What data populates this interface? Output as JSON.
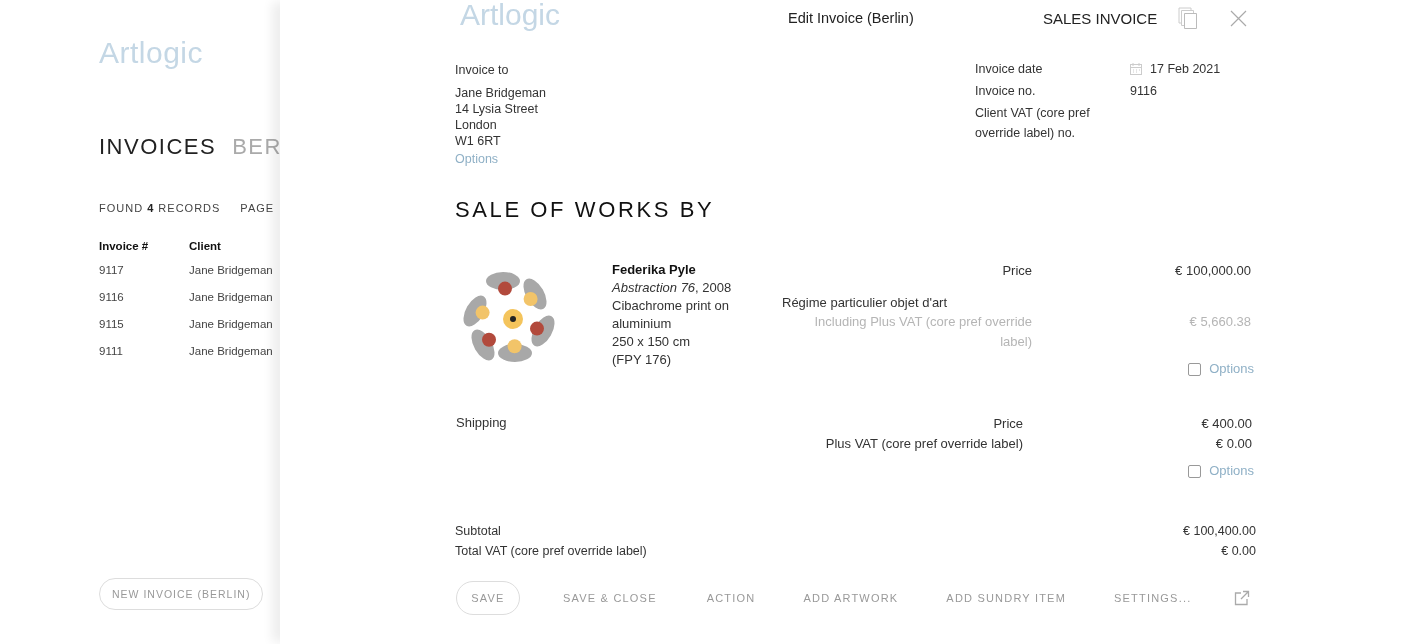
{
  "list_page": {
    "logo": "Artlogic",
    "title": "INVOICES",
    "title_suffix": "BER",
    "records": "FOUND **4** RECORDS",
    "page_label": "PAGE",
    "table": {
      "columns": [
        "Invoice #",
        "Client"
      ],
      "rows": [
        [
          "9117",
          "Jane Bridgeman"
        ],
        [
          "9116",
          "Jane Bridgeman"
        ],
        [
          "9115",
          "Jane Bridgeman"
        ],
        [
          "9111",
          "Jane Bridgeman"
        ]
      ]
    },
    "new_button": "NEW INVOICE (BERLIN)"
  },
  "invoice_panel": {
    "logo": "Artlogic",
    "title": "Edit Invoice (Berlin)",
    "invoice_type": "SALES INVOICE",
    "invoice_to": {
      "label": "Invoice to",
      "address": [
        "Jane Bridgeman",
        "14 Lysia Street",
        "London",
        "W1 6RT"
      ],
      "options": "Options"
    },
    "details": [
      {
        "kind": "date",
        "label": "Invoice date",
        "value": "17 Feb 2021"
      },
      {
        "kind": "text",
        "label": "Invoice no.",
        "value": "9116"
      },
      {
        "kind": "text",
        "label": "Client VAT (core pref override label) no."
      }
    ],
    "section_title": "SALE OF WORKS BY",
    "items": [
      {
        "kind": "artwork",
        "artist": "Federika Pyle",
        "title_line": "*Abstraction 76*, 2008",
        "medium": "Cibachrome print on aluminium",
        "dimensions": "250 x 150 cm",
        "reference": "(FPY 176)",
        "lines": [
          {
            "kind": "amount",
            "label": "Price",
            "value": "€ 100,000.00",
            "muted": false
          },
          {
            "kind": "note",
            "label": "Régime particulier objet d'art"
          },
          {
            "kind": "amount",
            "label": "Including Plus VAT (core pref override label)",
            "value": "€ 5,660.38",
            "muted": true
          }
        ],
        "checked": false,
        "options": "Options"
      },
      {
        "kind": "sundry",
        "label": "Shipping",
        "lines": [
          {
            "kind": "amount",
            "label": "Price",
            "value": "€ 400.00",
            "muted": false
          },
          {
            "kind": "amount",
            "label": "Plus VAT (core pref override label)",
            "value": "€ 0.00",
            "muted": false
          }
        ],
        "checked": false,
        "options": "Options"
      }
    ],
    "totals": [
      {
        "label": "Subtotal",
        "value": "€ 100,400.00"
      },
      {
        "label": "Total VAT (core pref override label)",
        "value": "€ 0.00"
      }
    ],
    "actions": [
      {
        "kind": "outlined",
        "label": "SAVE"
      },
      {
        "kind": "text",
        "label": "SAVE & CLOSE"
      },
      {
        "kind": "text",
        "label": "ACTION"
      },
      {
        "kind": "text",
        "label": "ADD ARTWORK"
      },
      {
        "kind": "text",
        "label": "ADD SUNDRY ITEM"
      },
      {
        "kind": "text",
        "label": "SETTINGS..."
      },
      {
        "kind": "icon"
      }
    ]
  }
}
